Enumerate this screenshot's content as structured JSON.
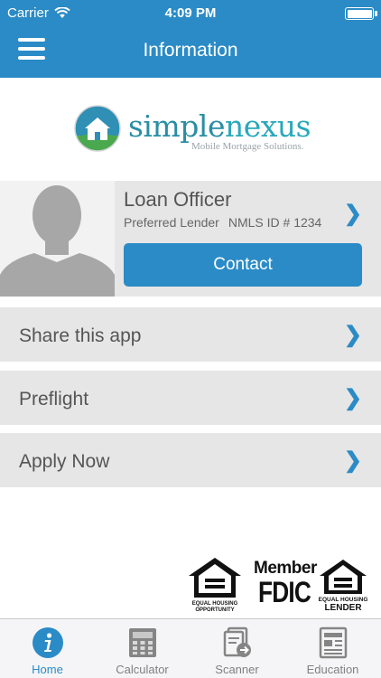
{
  "status_bar": {
    "carrier": "Carrier",
    "time": "4:09 PM"
  },
  "nav": {
    "title": "Information"
  },
  "logo": {
    "brand_part1": "simple",
    "brand_part2": "nexus",
    "tagline": "Mobile Mortgage Solutions."
  },
  "officer": {
    "name": "Loan Officer",
    "subtitle_left": "Preferred Lender",
    "subtitle_right": "NMLS ID # 1234",
    "contact_label": "Contact"
  },
  "rows": [
    {
      "label": "Share this app"
    },
    {
      "label": "Preflight"
    },
    {
      "label": "Apply Now"
    }
  ],
  "badges": {
    "equal_housing_opportunity": "EQUAL HOUSING OPPORTUNITY",
    "fdic_member": "Member",
    "fdic": "FDIC",
    "equal_housing_lender": "EQUAL HOUSING LENDER"
  },
  "tabs": [
    {
      "label": "Home",
      "icon": "info-icon",
      "active": true
    },
    {
      "label": "Calculator",
      "icon": "calculator-icon",
      "active": false
    },
    {
      "label": "Scanner",
      "icon": "scanner-icon",
      "active": false
    },
    {
      "label": "Education",
      "icon": "newspaper-icon",
      "active": false
    }
  ],
  "colors": {
    "accent": "#2b8bc6",
    "row_bg": "#e6e6e6",
    "text": "#555555"
  }
}
